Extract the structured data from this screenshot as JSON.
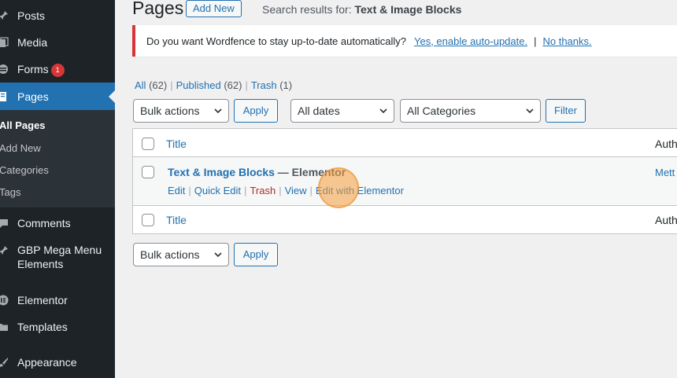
{
  "sidebar": {
    "items": [
      {
        "name": "posts",
        "icon": "pin-icon",
        "label": "Posts"
      },
      {
        "name": "media",
        "icon": "media-icon",
        "label": "Media"
      },
      {
        "name": "forms",
        "icon": "forms-icon",
        "label": "Forms",
        "badge": "1"
      },
      {
        "name": "pages",
        "icon": "pages-icon",
        "label": "Pages",
        "active": true
      },
      {
        "name": "comments",
        "icon": "comments-icon",
        "label": "Comments"
      },
      {
        "name": "gbp-mega-menu",
        "icon": "pin-icon",
        "label_line1": "GBP Mega Menu",
        "label_line2": "Elements"
      },
      {
        "name": "elementor",
        "icon": "elementor-icon",
        "label": "Elementor"
      },
      {
        "name": "templates",
        "icon": "folder-icon",
        "label": "Templates"
      },
      {
        "name": "appearance",
        "icon": "brush-icon",
        "label": "Appearance"
      }
    ],
    "submenu": [
      "All Pages",
      "Add New",
      "Categories",
      "Tags"
    ]
  },
  "header": {
    "title": "Pages",
    "add_new": "Add New",
    "search_prefix": "Search results for: ",
    "search_term": "Text & Image Blocks"
  },
  "notice": {
    "text": "Do you want Wordfence to stay up-to-date automatically?",
    "link_yes": "Yes, enable auto-update.",
    "separator": "|",
    "link_no": "No thanks."
  },
  "views": {
    "all": "All",
    "all_count": "(62)",
    "published": "Published",
    "published_count": "(62)",
    "trash": "Trash",
    "trash_count": "(1)",
    "separator": "|"
  },
  "filters": {
    "bulk_actions": "Bulk actions",
    "apply": "Apply",
    "dates": "All dates",
    "categories": "All Categories",
    "filter": "Filter"
  },
  "table": {
    "columns": {
      "title": "Title",
      "author": "Auth"
    },
    "rows": [
      {
        "title": "Text & Image Blocks",
        "state": " — Elementor",
        "author": "Mett",
        "actions": [
          "Edit",
          "Quick Edit",
          "Trash",
          "View",
          "Edit with Elementor"
        ]
      }
    ]
  },
  "colors": {
    "sidebar_bg": "#1d2327",
    "active_menu": "#2271b1",
    "link": "#2271b1",
    "notice_border": "#d63638",
    "trash": "#b32d2e",
    "cursor_halo": "#f59e3c"
  }
}
